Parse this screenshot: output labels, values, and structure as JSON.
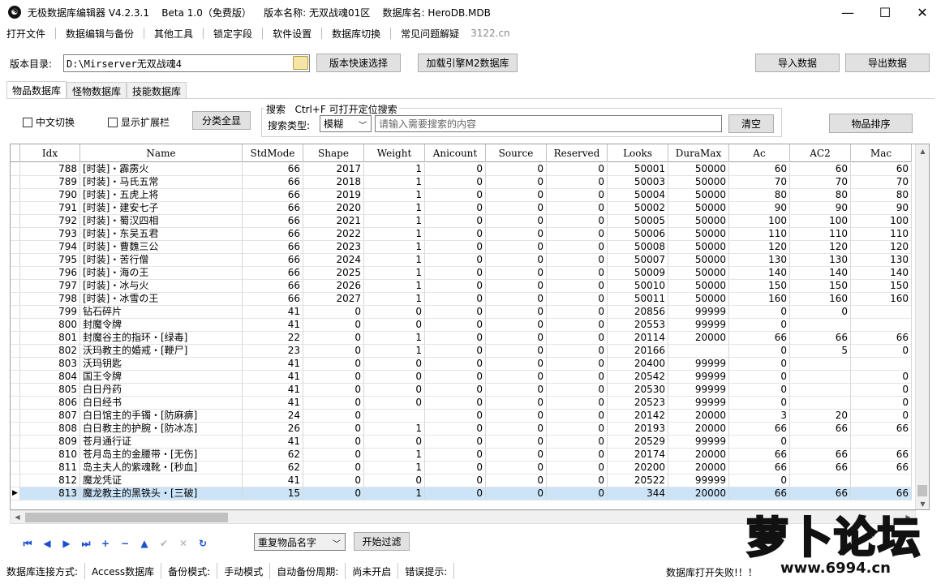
{
  "window": {
    "title": "无极数据库编辑器 V4.2.3.1    Beta 1.0（免费版）    版本名称: 无双战魂01区    数据库名: HeroDB.MDB",
    "minimize": "—",
    "maximize": "☐",
    "close": "✕"
  },
  "menu": [
    "打开文件",
    "数据编辑与备份",
    "其他工具",
    "锁定字段",
    "软件设置",
    "数据库切换",
    "常见问题解疑"
  ],
  "menu_site": "3122.cn",
  "toolbar": {
    "version_dir_label": "版本目录:",
    "version_dir_value": "D:\\Mirserver无双战魂4",
    "quick_select": "版本快速选择",
    "load_engine": "加载引擎M2数据库",
    "import": "导入数据",
    "export": "导出数据"
  },
  "tabs": [
    "物品数据库",
    "怪物数据库",
    "技能数据库"
  ],
  "filters": {
    "chinese_switch": "中文切换",
    "show_ext": "显示扩展栏",
    "show_all": "分类全显",
    "search_group_title": "搜索   Ctrl+F 可打开定位搜索",
    "search_type_label": "搜索类型:",
    "search_type_value": "模糊",
    "search_placeholder": "请输入需要搜索的内容",
    "clear": "清空",
    "sort": "物品排序"
  },
  "grid": {
    "columns": [
      "Idx",
      "Name",
      "StdMode",
      "Shape",
      "Weight",
      "Anicount",
      "Source",
      "Reserved",
      "Looks",
      "DuraMax",
      "Ac",
      "AC2",
      "Mac"
    ],
    "rows": [
      [
        "788",
        "[时装]・霹雳火",
        "66",
        "2017",
        "1",
        "0",
        "0",
        "0",
        "50001",
        "50000",
        "60",
        "60",
        "60"
      ],
      [
        "789",
        "[时装]・马氏五常",
        "66",
        "2018",
        "1",
        "0",
        "0",
        "0",
        "50003",
        "50000",
        "70",
        "70",
        "70"
      ],
      [
        "790",
        "[时装]・五虎上将",
        "66",
        "2019",
        "1",
        "0",
        "0",
        "0",
        "50004",
        "50000",
        "80",
        "80",
        "80"
      ],
      [
        "791",
        "[时装]・建安七子",
        "66",
        "2020",
        "1",
        "0",
        "0",
        "0",
        "50002",
        "50000",
        "90",
        "90",
        "90"
      ],
      [
        "792",
        "[时装]・蜀汉四相",
        "66",
        "2021",
        "1",
        "0",
        "0",
        "0",
        "50005",
        "50000",
        "100",
        "100",
        "100"
      ],
      [
        "793",
        "[时装]・东吴五君",
        "66",
        "2022",
        "1",
        "0",
        "0",
        "0",
        "50006",
        "50000",
        "110",
        "110",
        "110"
      ],
      [
        "794",
        "[时装]・曹魏三公",
        "66",
        "2023",
        "1",
        "0",
        "0",
        "0",
        "50008",
        "50000",
        "120",
        "120",
        "120"
      ],
      [
        "795",
        "[时装]・苦行僧",
        "66",
        "2024",
        "1",
        "0",
        "0",
        "0",
        "50007",
        "50000",
        "130",
        "130",
        "130"
      ],
      [
        "796",
        "[时装]・海の王",
        "66",
        "2025",
        "1",
        "0",
        "0",
        "0",
        "50009",
        "50000",
        "140",
        "140",
        "140"
      ],
      [
        "797",
        "[时装]・冰与火",
        "66",
        "2026",
        "1",
        "0",
        "0",
        "0",
        "50010",
        "50000",
        "150",
        "150",
        "150"
      ],
      [
        "798",
        "[时装]・冰雪の王",
        "66",
        "2027",
        "1",
        "0",
        "0",
        "0",
        "50011",
        "50000",
        "160",
        "160",
        "160"
      ],
      [
        "799",
        "钻石碎片",
        "41",
        "0",
        "0",
        "0",
        "0",
        "0",
        "20856",
        "99999",
        "0",
        "0",
        ""
      ],
      [
        "800",
        "封魔令牌",
        "41",
        "0",
        "0",
        "0",
        "0",
        "0",
        "20553",
        "99999",
        "0",
        "",
        ""
      ],
      [
        "801",
        "封魔谷主的指环・[绿毒]",
        "22",
        "0",
        "1",
        "0",
        "0",
        "0",
        "20114",
        "20000",
        "66",
        "66",
        "66"
      ],
      [
        "802",
        "沃玛教主的婚戒・[鞭尸]",
        "23",
        "0",
        "1",
        "0",
        "0",
        "0",
        "20166",
        "",
        "0",
        "5",
        "0"
      ],
      [
        "803",
        "沃玛钥匙",
        "41",
        "0",
        "0",
        "0",
        "0",
        "0",
        "20400",
        "99999",
        "0",
        "",
        ""
      ],
      [
        "804",
        "国王令牌",
        "41",
        "0",
        "0",
        "0",
        "0",
        "0",
        "20542",
        "99999",
        "0",
        "",
        "0"
      ],
      [
        "805",
        "白日丹药",
        "41",
        "0",
        "0",
        "0",
        "0",
        "0",
        "20530",
        "99999",
        "0",
        "",
        "0"
      ],
      [
        "806",
        "白日经书",
        "41",
        "0",
        "0",
        "0",
        "0",
        "0",
        "20523",
        "99999",
        "0",
        "",
        "0"
      ],
      [
        "807",
        "白日馆主的手镯・[防麻痹]",
        "24",
        "0",
        "",
        "0",
        "0",
        "0",
        "20142",
        "20000",
        "3",
        "20",
        "0"
      ],
      [
        "808",
        "白日教主的护腕・[防冰冻]",
        "26",
        "0",
        "1",
        "0",
        "0",
        "0",
        "20193",
        "20000",
        "66",
        "66",
        "66"
      ],
      [
        "809",
        "苍月通行证",
        "41",
        "0",
        "0",
        "0",
        "0",
        "0",
        "20529",
        "99999",
        "0",
        "",
        ""
      ],
      [
        "810",
        "苍月岛主的金腰带・[无伤]",
        "62",
        "0",
        "1",
        "0",
        "0",
        "0",
        "20174",
        "20000",
        "66",
        "66",
        "66"
      ],
      [
        "811",
        "岛主夫人的紫魂靴・[秒血]",
        "62",
        "0",
        "1",
        "0",
        "0",
        "0",
        "20200",
        "20000",
        "66",
        "66",
        "66"
      ],
      [
        "812",
        "魔龙凭证",
        "41",
        "0",
        "0",
        "0",
        "0",
        "0",
        "20522",
        "99999",
        "0",
        "",
        ""
      ],
      [
        "813",
        "魔龙教主的黑铁头・[三破]",
        "15",
        "0",
        "1",
        "0",
        "0",
        "0",
        "344",
        "20000",
        "66",
        "66",
        "66"
      ]
    ],
    "selected_index": 25
  },
  "nav": {
    "buttons": [
      {
        "name": "first-record",
        "glyph": "⏮"
      },
      {
        "name": "prior-record",
        "glyph": "◀"
      },
      {
        "name": "next-record",
        "glyph": "▶"
      },
      {
        "name": "last-record",
        "glyph": "⏭"
      },
      {
        "name": "insert-record",
        "glyph": "+"
      },
      {
        "name": "delete-record",
        "glyph": "−"
      },
      {
        "name": "edit-record",
        "glyph": "▲"
      },
      {
        "name": "post-record",
        "glyph": "✔"
      },
      {
        "name": "cancel-record",
        "glyph": "✕"
      },
      {
        "name": "refresh-record",
        "glyph": "↻"
      }
    ],
    "dup_filter_value": "重复物品名字",
    "start_filter": "开始过滤"
  },
  "status": [
    "数据库连接方式:",
    "Access数据库",
    "备份模式:",
    "手动模式",
    "自动备份周期:",
    "尚未开启",
    "错误提示:"
  ],
  "status_error": "数据库打开失败!！！",
  "watermark": {
    "text": "萝卜论坛",
    "url": "www.6994.cn"
  }
}
